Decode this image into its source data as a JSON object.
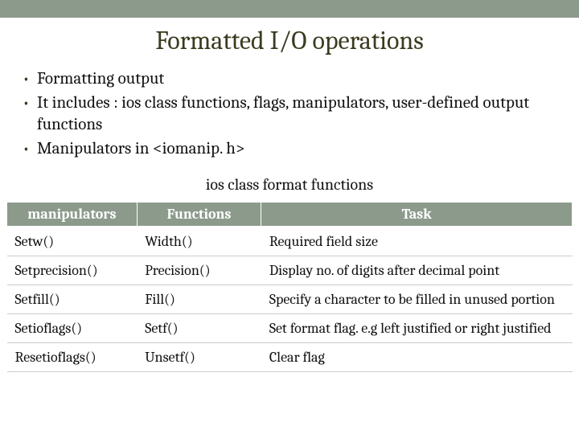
{
  "title": "Formatted I/O operations",
  "bullets": [
    "Formatting output",
    "It includes : ios class functions, flags, manipulators, user-defined output functions",
    "Manipulators in <iomanip. h>"
  ],
  "subheading": "ios class format functions",
  "table": {
    "headers": [
      "manipulators",
      "Functions",
      "Task"
    ],
    "rows": [
      {
        "c0": "Setw()",
        "c1": "Width()",
        "c2": "Required field size"
      },
      {
        "c0": "Setprecision()",
        "c1": "Precision()",
        "c2": "Display no. of digits after decimal point"
      },
      {
        "c0": "Setfill()",
        "c1": "Fill()",
        "c2": "Specify a character to be filled in unused portion"
      },
      {
        "c0": "Setioflags()",
        "c1": "Setf()",
        "c2": "Set format flag. e.g left justified or right justified"
      },
      {
        "c0": "Resetioflags()",
        "c1": "Unsetf()",
        "c2": "Clear flag"
      }
    ]
  }
}
